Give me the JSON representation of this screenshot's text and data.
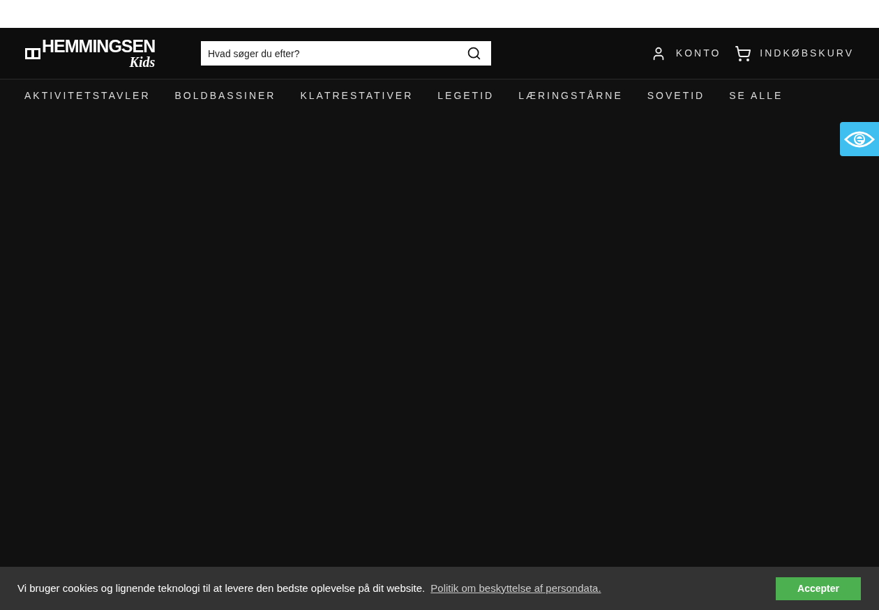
{
  "header": {
    "logo": {
      "name": "HEMMINGSEN",
      "sub": "Kids"
    },
    "search": {
      "placeholder": "Hvad søger du efter?"
    },
    "account": "KONTO",
    "cart": "INDKØBSKURV"
  },
  "nav": [
    "AKTIVITETSTAVLER",
    "BOLDBASSINER",
    "KLATRESTATIVER",
    "LEGETID",
    "LÆRINGSTÅRNE",
    "SOVETID",
    "SE ALLE"
  ],
  "cookie_banner": {
    "message": "Vi bruger cookies og lignende teknologi til at levere den bedste oplevelse på dit website.",
    "link": "Politik om beskyttelse af persondata.",
    "button": "Accepter"
  }
}
